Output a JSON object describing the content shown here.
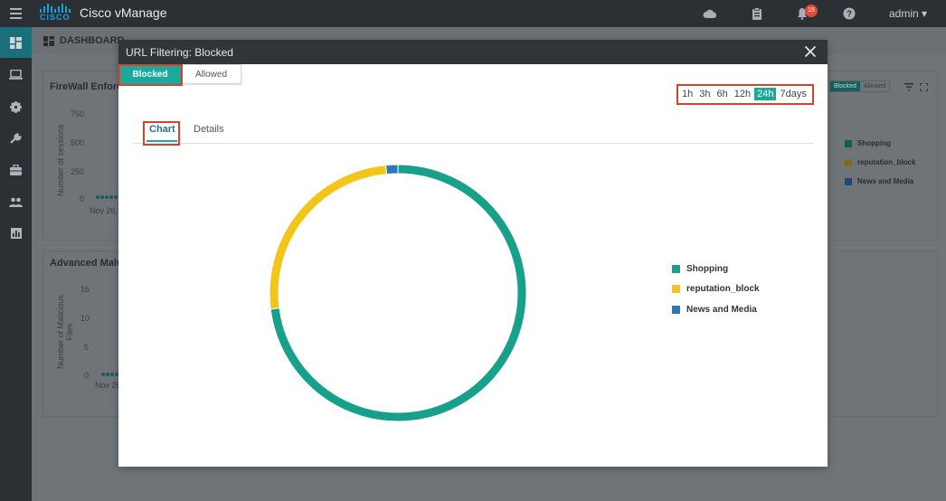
{
  "app": {
    "title": "Cisco vManage",
    "logo_text": "CISCO",
    "user": "admin ▾",
    "notification_count": "15"
  },
  "colors": {
    "accent": "#1aaa99",
    "shopping": "#17a08a",
    "reputation_block": "#f2c618",
    "news_and_media": "#2e78b7",
    "highlight": "#d9412f"
  },
  "icons": {
    "menu": "hamburger-icon",
    "cloud": "cloud-icon",
    "tasks": "clipboard-icon",
    "alerts": "bell-icon",
    "help": "help-icon",
    "nav": [
      "dashboard-icon",
      "monitor-icon",
      "gear-icon",
      "wrench-icon",
      "briefcase-icon",
      "users-icon",
      "analytics-icon"
    ],
    "close": "close-icon"
  },
  "background": {
    "dashboard_title": "DASHBOARD",
    "firewall_panel": {
      "title": "FireWall Enforc",
      "ylabel": "Number of sessions",
      "ticks": [
        "750",
        "500",
        "250",
        "0"
      ],
      "xtick": "Nov 26,"
    },
    "malware_panel": {
      "title": "Advanced Malw",
      "ylabel": "Number of Malicious Files",
      "ticks": [
        "15",
        "10",
        "5",
        "0"
      ],
      "xtick": "Nov 26"
    },
    "right_panel": {
      "toggle": [
        "Blocked",
        "Allowed"
      ],
      "legend": [
        "Shopping",
        "reputation_block",
        "News and Media"
      ]
    }
  },
  "modal": {
    "title": "URL Filtering: Blocked",
    "segments": [
      {
        "label": "Blocked",
        "active": true
      },
      {
        "label": "Allowed",
        "active": false
      }
    ],
    "time_ranges": [
      "1h",
      "3h",
      "6h",
      "12h",
      "24h",
      "7days"
    ],
    "selected_time_range": "24h",
    "tabs": [
      {
        "label": "Chart",
        "active": true
      },
      {
        "label": "Details",
        "active": false
      }
    ]
  },
  "chart_data": {
    "type": "pie",
    "hole": true,
    "title": "",
    "legend_position": "right",
    "categories": [
      "Shopping",
      "reputation_block",
      "News and Media"
    ],
    "values": [
      73,
      25.5,
      1.5
    ],
    "colors": [
      "#17a08a",
      "#f2c618",
      "#2e78b7"
    ]
  }
}
